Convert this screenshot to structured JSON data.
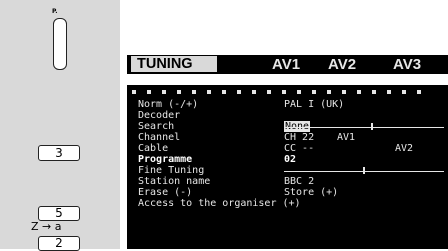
{
  "remote": {
    "p_label": "P.",
    "button_3": "3",
    "button_5": "5",
    "z_to_a": "Z → a",
    "button_2": "2"
  },
  "header": {
    "active_tab": "TUNING",
    "tabs": [
      "AV1",
      "AV2",
      "AV3"
    ]
  },
  "menu": {
    "rows": [
      {
        "label": "Norm (-/+)",
        "value": "PAL I (UK)"
      },
      {
        "label": "Decoder",
        "value": ""
      },
      {
        "label": "Search",
        "value": ""
      },
      {
        "label": "Channel",
        "value": "CH 22"
      },
      {
        "label": "Cable",
        "value": "CC --"
      },
      {
        "label": "Programme",
        "value": "02"
      },
      {
        "label": "Fine Tuning",
        "value": ""
      },
      {
        "label": "Station name",
        "value": "BBC 2"
      },
      {
        "label": "Erase (-)",
        "value": "Store (+)"
      },
      {
        "label": "Access to the organiser (+)",
        "value": ""
      }
    ],
    "decoder_options": [
      "None",
      "AV1",
      "AV2"
    ],
    "decoder_selected": "None",
    "search_slider_fraction": 0.55,
    "fine_tuning_slider_fraction": 0.5
  },
  "colors": {
    "screen_bg": "#000000",
    "screen_text": "#e6e6e6",
    "remote_bg": "#d9d9d9",
    "active_tab_bg": "#d9d9d9"
  }
}
